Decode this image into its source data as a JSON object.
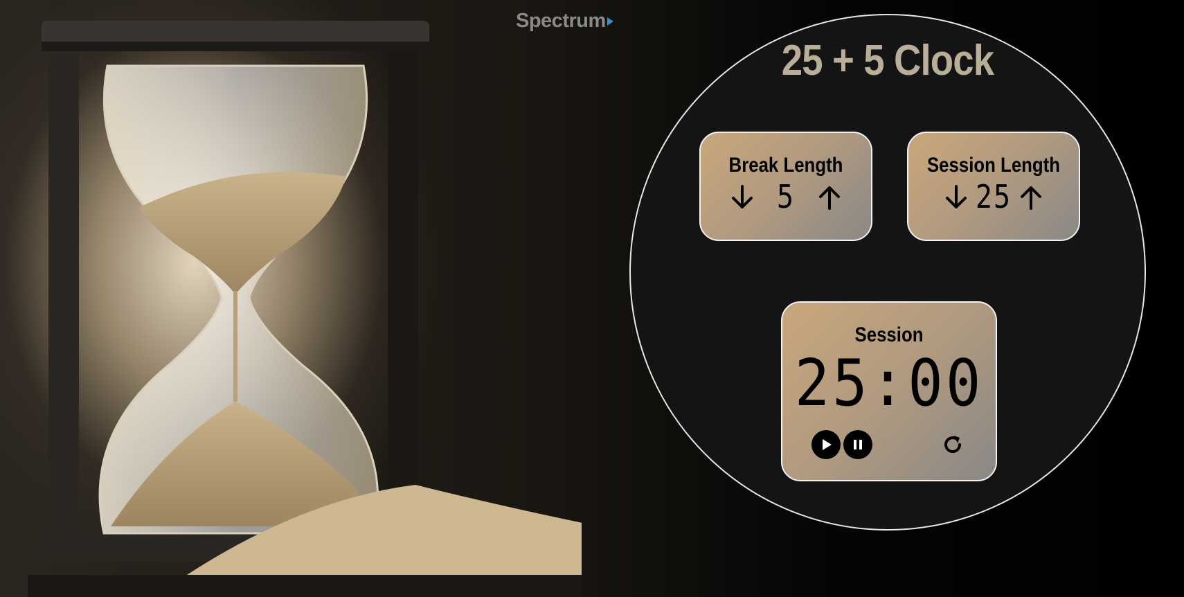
{
  "brand": {
    "name": "Spectrum"
  },
  "clock": {
    "title": "25 + 5 Clock",
    "break": {
      "label": "Break Length",
      "value": "5"
    },
    "session": {
      "label": "Session Length",
      "value": "25"
    },
    "timer": {
      "label": "Session",
      "time": "25:00"
    }
  },
  "icons": {
    "decrement": "arrow-down-icon",
    "increment": "arrow-up-icon",
    "play": "play-icon",
    "pause": "pause-icon",
    "reset": "refresh-icon"
  },
  "colors": {
    "title": "#b9ae98",
    "panel_start": "#c9a77b",
    "panel_end": "#8a8886",
    "circle_bg": "#141414",
    "brand_arrow": "#2d8fd5"
  }
}
